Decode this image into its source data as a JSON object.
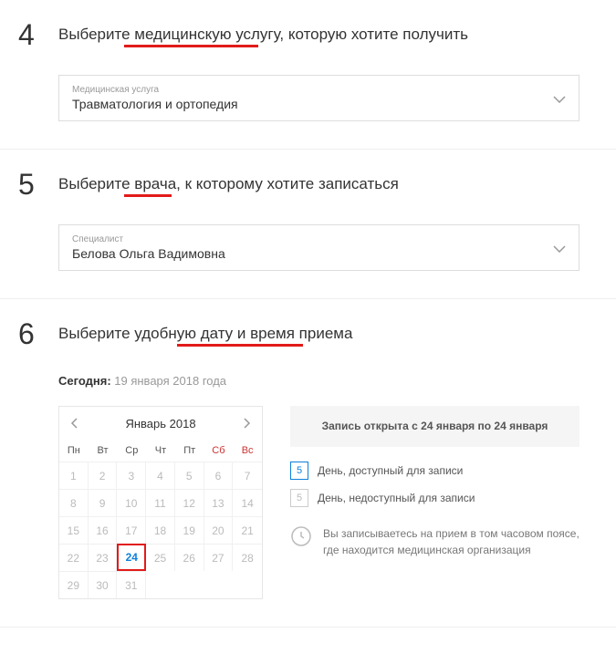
{
  "step4": {
    "num": "4",
    "title": "Выберите медицинскую услугу, которую хотите получить",
    "dropdown_label": "Медицинская услуга",
    "dropdown_value": "Травматология и ортопедия"
  },
  "step5": {
    "num": "5",
    "title": "Выберите врача, к которому хотите записаться",
    "dropdown_label": "Специалист",
    "dropdown_value": "Белова Ольга Вадимовна"
  },
  "step6": {
    "num": "6",
    "title": "Выберите удобную дату и время приема",
    "today_label": "Сегодня:",
    "today_date": " 19 января 2018 года",
    "cal": {
      "month": "Январь 2018",
      "dow": [
        "Пн",
        "Вт",
        "Ср",
        "Чт",
        "Пт",
        "Сб",
        "Вс"
      ],
      "days": [
        "1",
        "2",
        "3",
        "4",
        "5",
        "6",
        "7",
        "8",
        "9",
        "10",
        "11",
        "12",
        "13",
        "14",
        "15",
        "16",
        "17",
        "18",
        "19",
        "20",
        "21",
        "22",
        "23",
        "24",
        "25",
        "26",
        "27",
        "28",
        "29",
        "30",
        "31"
      ],
      "selected": "24"
    },
    "legend": {
      "banner": "Запись открыта с 24 января по 24 января",
      "avail_num": "5",
      "avail_text": "День, доступный для записи",
      "unavail_num": "5",
      "unavail_text": "День, недоступный для записи",
      "tz_text": "Вы записываетесь на прием в том часовом поясе, где находится медицинская организация"
    }
  }
}
